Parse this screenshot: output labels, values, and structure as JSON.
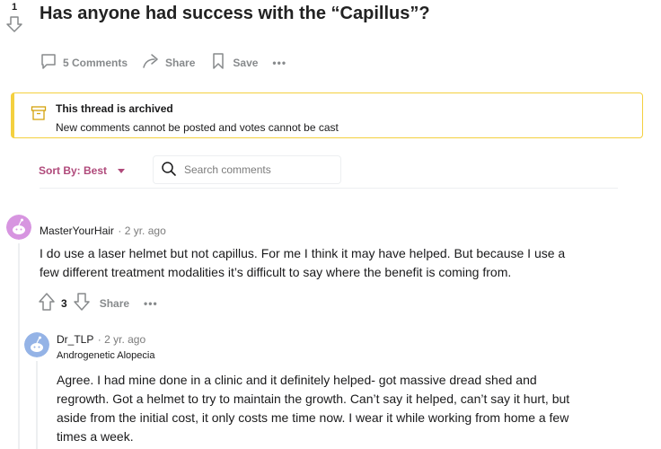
{
  "post": {
    "votes": "1",
    "title": "Has anyone had success with the “Capillus”?",
    "comments_label": "5 Comments",
    "share_label": "Share",
    "save_label": "Save",
    "more_label": "•••"
  },
  "archived": {
    "title": "This thread is archived",
    "subtitle": "New comments cannot be posted and votes cannot be cast"
  },
  "sort": {
    "label": "Sort By: Best"
  },
  "search": {
    "placeholder": "Search comments"
  },
  "comments": [
    {
      "author": "MasterYourHair",
      "time": "· 2 yr. ago",
      "lines": [
        "I do use a laser helmet but not capillus. For me I think it may have helped. But because I use a",
        "few different treatment modalities it’s difficult to say where the benefit is coming from."
      ],
      "votes": "3",
      "share_label": "Share",
      "more_label": "•••"
    },
    {
      "author": "Dr_TLP",
      "time": "· 2 yr. ago",
      "flair": "Androgenetic Alopecia",
      "lines": [
        "Agree. I had mine done in a clinic and it definitely helped- got massive dread shed and",
        "regrowth. Got a helmet to try to maintain the growth. Can’t say it helped, can’t say it hurt, but",
        "aside from the initial cost, it only costs me time now. I wear it while working from home a few",
        "times a week."
      ]
    }
  ],
  "colors": {
    "accent": "#b04a7b",
    "archived_border": "#f4d03f",
    "muted": "#878a8c"
  }
}
